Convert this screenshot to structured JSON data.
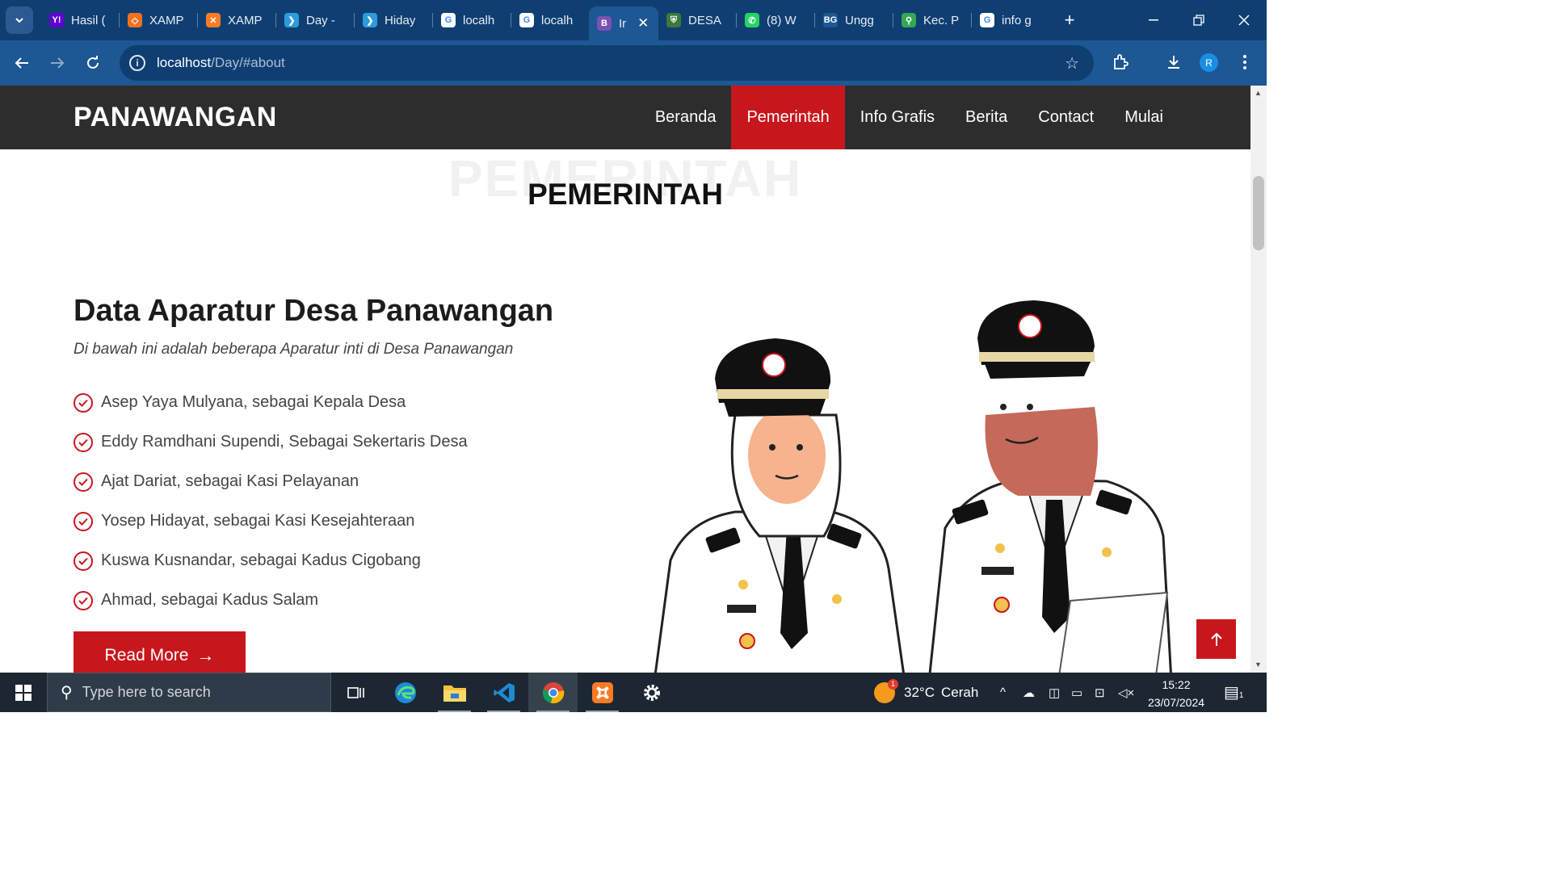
{
  "browser": {
    "tabs": [
      {
        "title": "Hasil (",
        "icon": "yahoo-icon",
        "color": "#6001d2",
        "glyph": "Y!"
      },
      {
        "title": "XAMP",
        "icon": "xampp-diamond-icon",
        "color": "#f37021",
        "glyph": "◇"
      },
      {
        "title": "XAMP",
        "icon": "xampp-icon",
        "color": "#fb7a24",
        "glyph": "✕"
      },
      {
        "title": "Day -",
        "icon": "day-icon",
        "color": "#2d9cdb",
        "glyph": "❯"
      },
      {
        "title": "Hiday",
        "icon": "day-icon",
        "color": "#2d9cdb",
        "glyph": "❯"
      },
      {
        "title": "localh",
        "icon": "google-icon",
        "color": "#ffffff",
        "glyph": "G"
      },
      {
        "title": "localh",
        "icon": "google-icon",
        "color": "#ffffff",
        "glyph": "G"
      },
      {
        "title": "Ir",
        "icon": "bootstrap-icon",
        "color": "#7952b3",
        "glyph": "B",
        "active": true
      },
      {
        "title": "DESA",
        "icon": "desa-crest-icon",
        "color": "#3a7a3a",
        "glyph": "⛨"
      },
      {
        "title": "(8) W",
        "icon": "whatsapp-icon",
        "color": "#25d366",
        "glyph": "✆"
      },
      {
        "title": "Ungg",
        "icon": "bg-icon",
        "color": "#1d5794",
        "glyph": "BG"
      },
      {
        "title": "Kec. P",
        "icon": "maps-pin-icon",
        "color": "#34a853",
        "glyph": "⚲"
      },
      {
        "title": "info g",
        "icon": "google-icon",
        "color": "#ffffff",
        "glyph": "G"
      }
    ],
    "address": {
      "host": "localhost",
      "path": "/Day/#about"
    },
    "profile_initial": "R"
  },
  "site": {
    "logo": "PANAWANGAN",
    "nav": [
      {
        "label": "Beranda"
      },
      {
        "label": "Pemerintah",
        "active": true
      },
      {
        "label": "Info Grafis"
      },
      {
        "label": "Berita"
      },
      {
        "label": "Contact"
      },
      {
        "label": "Mulai"
      }
    ],
    "section_bg": "PEMERINTAH",
    "section_title": "PEMERINTAH",
    "heading": "Data Aparatur Desa Panawangan",
    "subtitle": "Di bawah ini adalah beberapa Aparatur inti di Desa Panawangan",
    "officials": [
      "Asep Yaya Mulyana, sebagai Kepala Desa",
      "Eddy Ramdhani Supendi, Sebagai Sekertaris Desa",
      "Ajat Dariat, sebagai Kasi Pelayanan",
      "Yosep Hidayat, sebagai Kasi Kesejahteraan",
      "Kuswa Kusnandar, sebagai Kadus Cigobang",
      "Ahmad, sebagai Kadus Salam"
    ],
    "read_more": "Read More",
    "accent": "#c8161d"
  },
  "taskbar": {
    "search_placeholder": "Type here to search",
    "weather": {
      "temp": "32°C",
      "desc": "Cerah",
      "badge": "1"
    },
    "time": "15:22",
    "date": "23/07/2024",
    "notification_count": "1"
  }
}
